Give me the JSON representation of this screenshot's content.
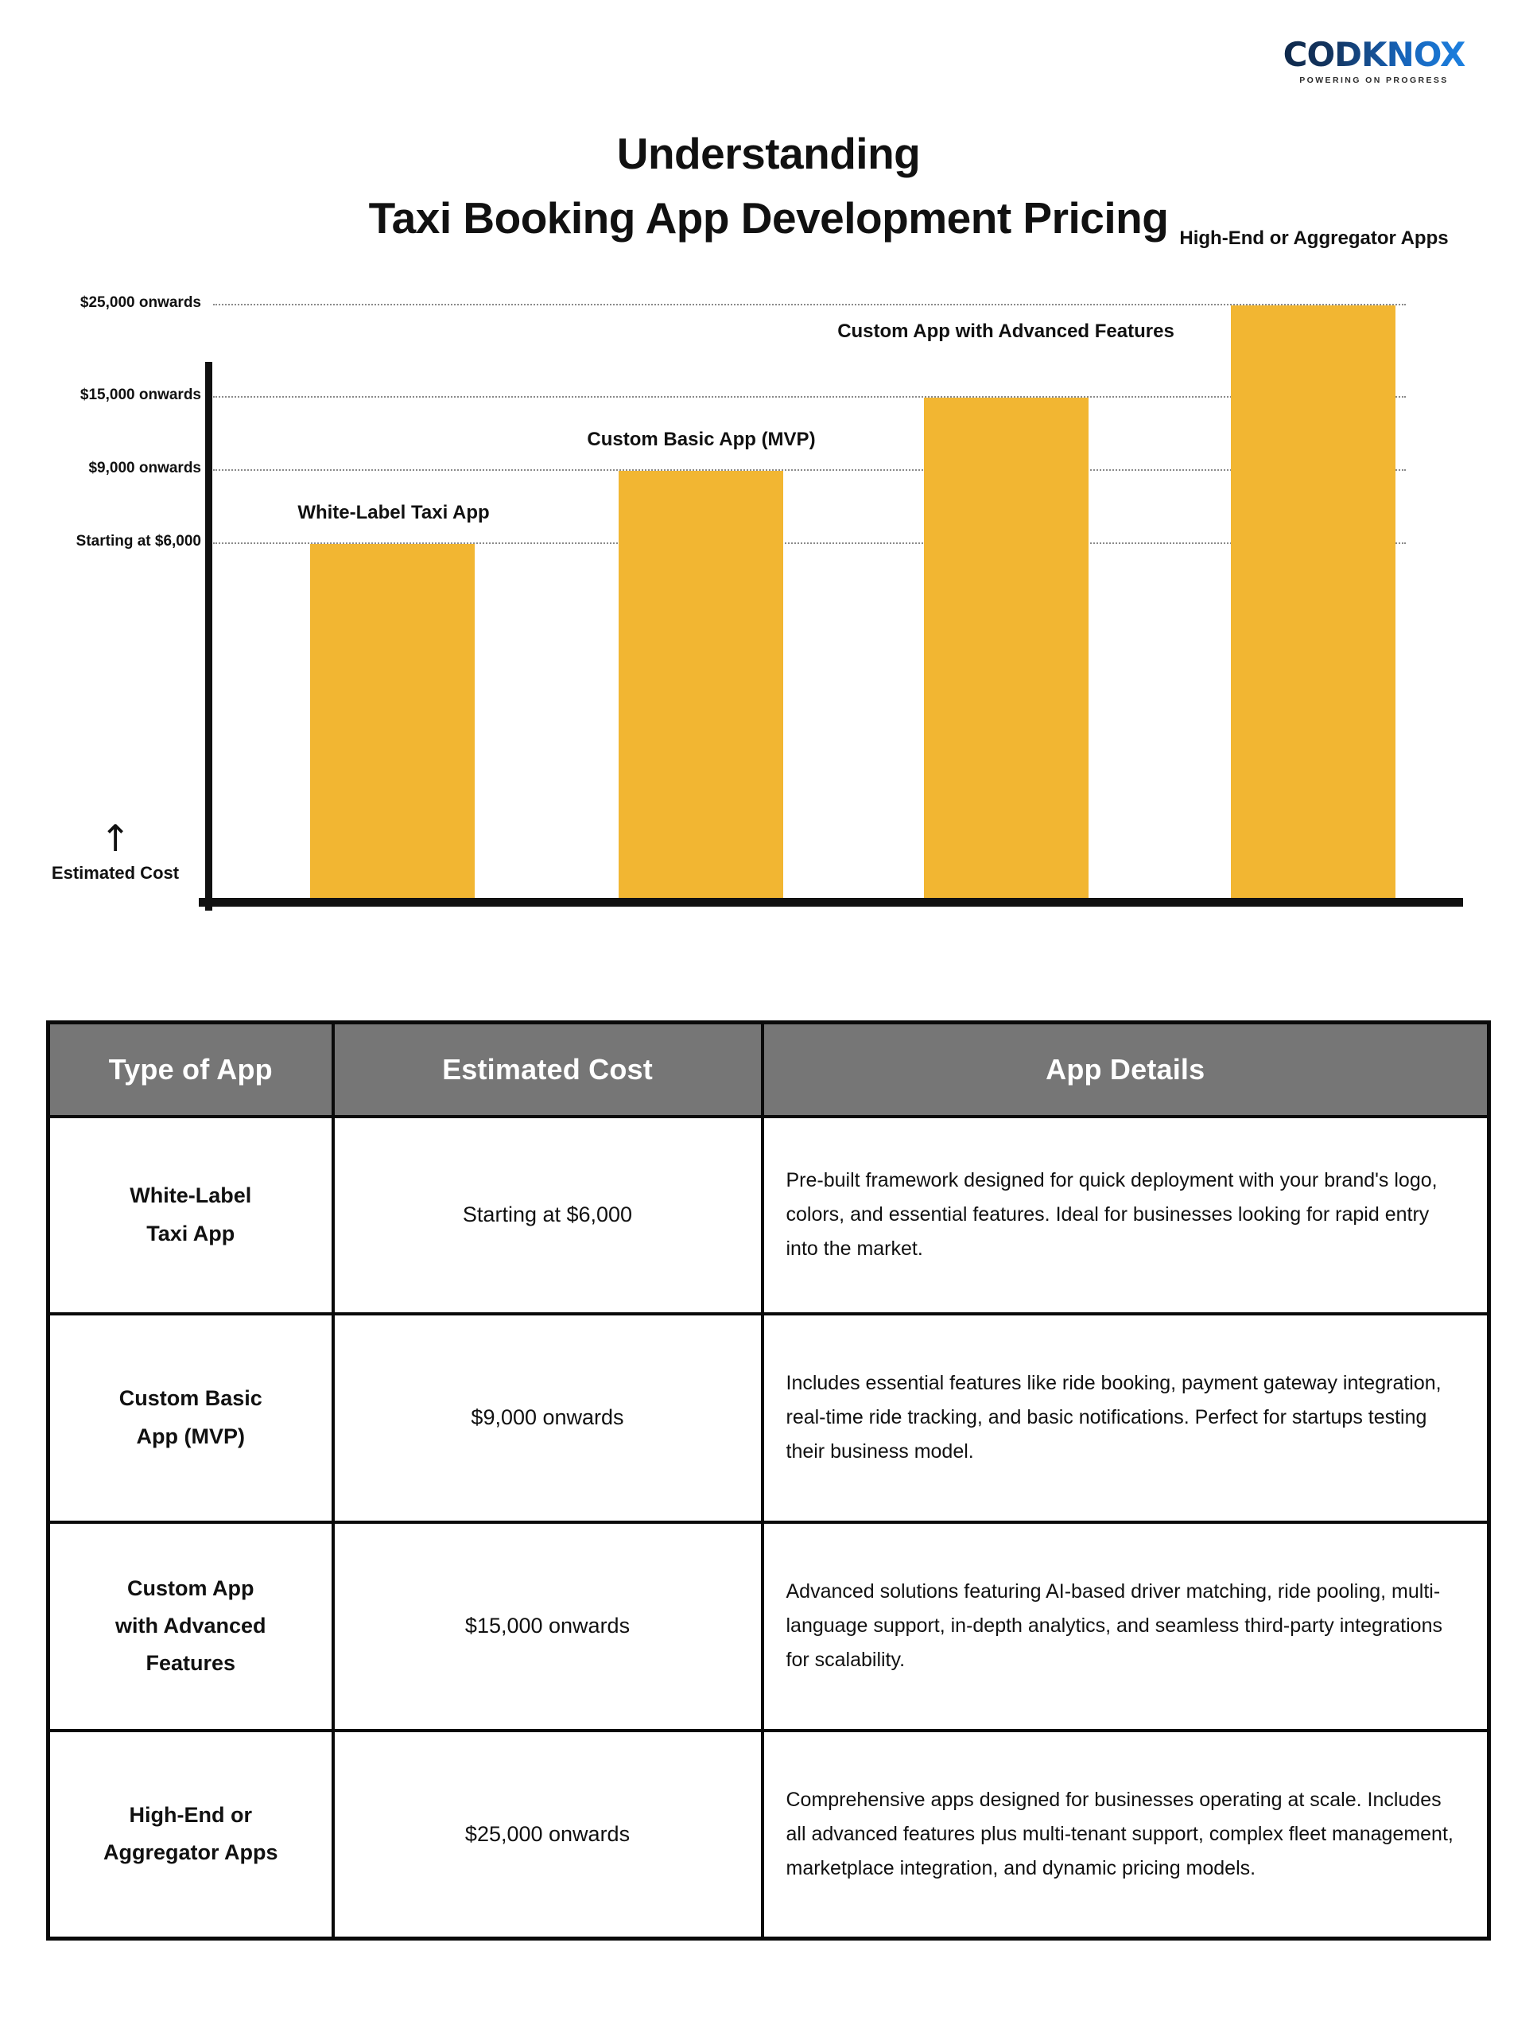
{
  "brand": {
    "name": "CODKNOX",
    "tagline": "POWERING ON PROGRESS",
    "color_dark": "#0d2340",
    "color_light": "#1f8cf0"
  },
  "title": {
    "line1": "Understanding",
    "line2": "Taxi Booking App Development Pricing"
  },
  "chart_data": {
    "type": "bar",
    "title": "Understanding Taxi Booking App Development Pricing",
    "xlabel": "",
    "ylabel": "Estimated Cost",
    "axis_arrow": "↑",
    "categories": [
      "White-Label Taxi App",
      "Custom Basic App (MVP)",
      "Custom App with Advanced Features",
      "High-End or Aggregator Apps"
    ],
    "values": [
      6000,
      9000,
      15000,
      25000
    ],
    "value_labels": [
      "Starting at $6,000",
      "$9,000 onwards",
      "$15,000 onwards",
      "$25,000 onwards"
    ],
    "ytick_labels": [
      "$25,000 onwards",
      "$15,000 onwards",
      "$9,000 onwards",
      "Starting at $6,000"
    ],
    "ytick_values": [
      25000,
      15000,
      9000,
      6000
    ],
    "ylim": [
      0,
      29000
    ],
    "grid": true,
    "legend": "none",
    "bar_color": "#F2B632",
    "bar_labels_position": "above-bar"
  },
  "table": {
    "headers": [
      "Type of App",
      "Estimated Cost",
      "App Details"
    ],
    "rows": [
      {
        "type": "White-Label\nTaxi App",
        "type_line1": "White-Label",
        "type_line2": "Taxi App",
        "cost": "Starting at $6,000",
        "details": "Pre-built framework designed for quick deployment with your brand's logo, colors, and essential features. Ideal for businesses looking for rapid entry into the market."
      },
      {
        "type_line1": "Custom Basic",
        "type_line2": "App (MVP)",
        "cost": "$9,000 onwards",
        "details": "Includes essential features like ride booking, payment gateway integration, real-time ride tracking, and basic notifications. Perfect for startups testing their business model."
      },
      {
        "type_line1": "Custom App",
        "type_line2": "with Advanced",
        "type_line3": "Features",
        "cost": "$15,000 onwards",
        "details": "Advanced solutions featuring AI-based driver matching, ride pooling, multi-language support, in-depth analytics, and seamless third-party integrations for scalability."
      },
      {
        "type_line1": "High-End or",
        "type_line2": "Aggregator Apps",
        "cost": "$25,000 onwards",
        "details": "Comprehensive apps designed for businesses operating at scale. Includes all advanced features plus multi-tenant support, complex fleet management, marketplace integration, and dynamic pricing models."
      }
    ]
  }
}
